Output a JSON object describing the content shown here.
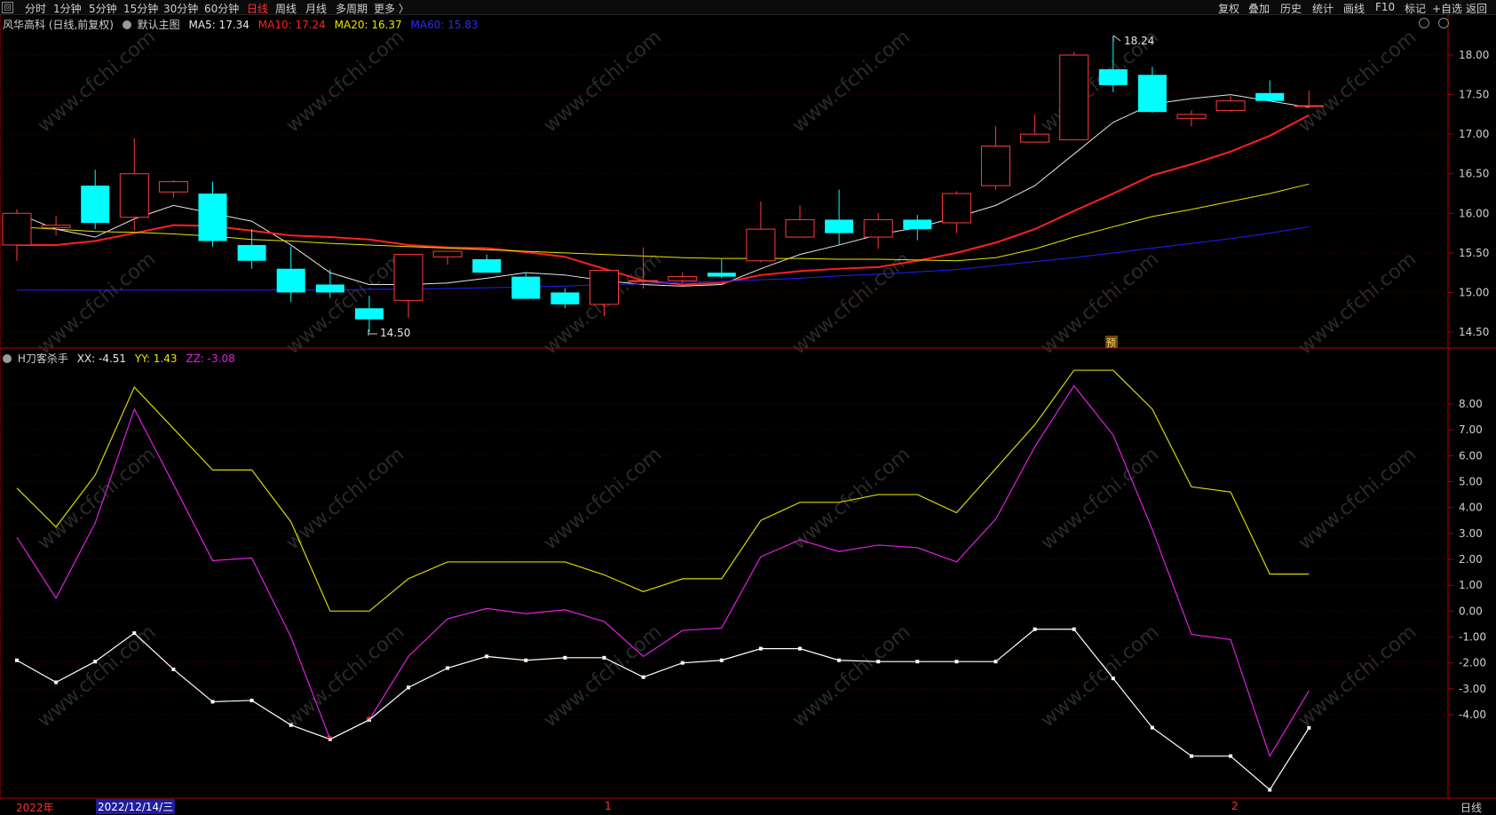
{
  "toolbar": {
    "app_icon": "回",
    "periods": [
      "分时",
      "1分钟",
      "5分钟",
      "15分钟",
      "30分钟",
      "60分钟",
      "日线",
      "周线",
      "月线",
      "多周期",
      "更多 〉"
    ],
    "active_period": "日线",
    "right_items": [
      "复权",
      "叠加",
      "历史",
      "统计",
      "画线",
      "F10",
      "标记",
      "+自选",
      "返回"
    ]
  },
  "main_legend": {
    "stock": "风华高科 (日线,前复权)",
    "chart_name": "默认主图",
    "ma5": "MA5: 17.34",
    "ma10": "MA10: 17.24",
    "ma20": "MA20: 16.37",
    "ma60": "MA60: 15.83"
  },
  "indicator_legend": {
    "name": "H刀客杀手",
    "xx": "XX: -4.51",
    "yy": "YY: 1.43",
    "zz": "ZZ: -3.08"
  },
  "annotations": {
    "high": "18.24",
    "low": "14.50",
    "forecast": "预"
  },
  "bottom": {
    "year": "2022年",
    "cursor_date": "2022/12/14/三",
    "month1": "1",
    "month2": "2",
    "period_tab": "日线"
  },
  "watermark": "www.cfchi.com",
  "colors": {
    "up": "#ff3c3c",
    "down": "#00ffff",
    "ma5": "#e6e6e6",
    "ma10": "#ff2020",
    "ma20": "#e6e600",
    "ma60": "#2020ff",
    "yy": "#d8d800",
    "zz": "#e020e0",
    "xx": "#ffffff",
    "axis": "#b00000"
  },
  "chart_data": [
    {
      "type": "candlestick",
      "title": "风华高科 (日线,前复权)",
      "ylim": [
        14.35,
        18.15
      ],
      "y_ticks": [
        14.5,
        15.0,
        15.5,
        16.0,
        16.5,
        17.0,
        17.5,
        18.0
      ],
      "y_tick_labels": [
        "14.50",
        "15.00",
        "15.50",
        "16.00",
        "16.50",
        "17.00",
        "17.50",
        "18.00"
      ],
      "candles": [
        {
          "o": 15.6,
          "h": 16.05,
          "l": 15.4,
          "c": 16.0
        },
        {
          "o": 15.82,
          "h": 15.97,
          "l": 15.72,
          "c": 15.85
        },
        {
          "o": 16.35,
          "h": 16.55,
          "l": 15.8,
          "c": 15.88
        },
        {
          "o": 15.95,
          "h": 16.95,
          "l": 15.78,
          "c": 16.5
        },
        {
          "o": 16.27,
          "h": 16.42,
          "l": 16.2,
          "c": 16.4
        },
        {
          "o": 16.25,
          "h": 16.4,
          "l": 15.58,
          "c": 15.65
        },
        {
          "o": 15.6,
          "h": 15.8,
          "l": 15.3,
          "c": 15.4
        },
        {
          "o": 15.3,
          "h": 15.58,
          "l": 14.88,
          "c": 15.0
        },
        {
          "o": 15.1,
          "h": 15.29,
          "l": 14.93,
          "c": 15.0
        },
        {
          "o": 14.8,
          "h": 14.96,
          "l": 14.5,
          "c": 14.66
        },
        {
          "o": 14.9,
          "h": 15.48,
          "l": 14.68,
          "c": 15.48
        },
        {
          "o": 15.45,
          "h": 15.52,
          "l": 15.35,
          "c": 15.52
        },
        {
          "o": 15.42,
          "h": 15.48,
          "l": 15.25,
          "c": 15.25
        },
        {
          "o": 15.2,
          "h": 15.25,
          "l": 14.92,
          "c": 14.92
        },
        {
          "o": 15.0,
          "h": 15.05,
          "l": 14.8,
          "c": 14.85
        },
        {
          "o": 14.85,
          "h": 15.28,
          "l": 14.7,
          "c": 15.28
        },
        {
          "o": 15.14,
          "h": 15.57,
          "l": 15.05,
          "c": 15.15
        },
        {
          "o": 15.15,
          "h": 15.25,
          "l": 15.12,
          "c": 15.2
        },
        {
          "o": 15.25,
          "h": 15.42,
          "l": 15.18,
          "c": 15.2
        },
        {
          "o": 15.4,
          "h": 16.15,
          "l": 15.38,
          "c": 15.8
        },
        {
          "o": 15.7,
          "h": 16.1,
          "l": 15.7,
          "c": 15.92
        },
        {
          "o": 15.92,
          "h": 16.3,
          "l": 15.6,
          "c": 15.75
        },
        {
          "o": 15.7,
          "h": 16.0,
          "l": 15.55,
          "c": 15.92
        },
        {
          "o": 15.92,
          "h": 15.98,
          "l": 15.66,
          "c": 15.8
        },
        {
          "o": 15.88,
          "h": 16.28,
          "l": 15.75,
          "c": 16.25
        },
        {
          "o": 16.35,
          "h": 17.1,
          "l": 16.3,
          "c": 16.85
        },
        {
          "o": 16.9,
          "h": 17.25,
          "l": 16.9,
          "c": 17.0
        },
        {
          "o": 16.93,
          "h": 18.04,
          "l": 16.92,
          "c": 18.0
        },
        {
          "o": 17.82,
          "h": 18.24,
          "l": 17.53,
          "c": 17.62
        },
        {
          "o": 17.75,
          "h": 17.85,
          "l": 17.27,
          "c": 17.28
        },
        {
          "o": 17.2,
          "h": 17.3,
          "l": 17.1,
          "c": 17.25
        },
        {
          "o": 17.3,
          "h": 17.48,
          "l": 17.28,
          "c": 17.42
        },
        {
          "o": 17.52,
          "h": 17.68,
          "l": 17.42,
          "c": 17.42
        },
        {
          "o": 17.36,
          "h": 17.55,
          "l": 17.33,
          "c": 17.36
        }
      ],
      "ma_series": [
        {
          "name": "MA5",
          "values": [
            16.0,
            15.8,
            15.7,
            15.93,
            16.1,
            16.0,
            15.9,
            15.6,
            15.25,
            15.1,
            15.1,
            15.12,
            15.18,
            15.25,
            15.22,
            15.15,
            15.1,
            15.08,
            15.1,
            15.3,
            15.48,
            15.6,
            15.73,
            15.82,
            15.95,
            16.1,
            16.35,
            16.75,
            17.15,
            17.38,
            17.45,
            17.5,
            17.42,
            17.34
          ]
        },
        {
          "name": "MA10",
          "values": [
            15.6,
            15.6,
            15.65,
            15.75,
            15.85,
            15.84,
            15.78,
            15.72,
            15.7,
            15.67,
            15.6,
            15.57,
            15.56,
            15.51,
            15.45,
            15.3,
            15.15,
            15.1,
            15.12,
            15.22,
            15.27,
            15.3,
            15.32,
            15.4,
            15.5,
            15.63,
            15.8,
            16.03,
            16.25,
            16.48,
            16.62,
            16.78,
            16.98,
            17.24
          ]
        },
        {
          "name": "MA20",
          "values": [
            15.83,
            15.8,
            15.77,
            15.76,
            15.74,
            15.71,
            15.67,
            15.65,
            15.62,
            15.6,
            15.58,
            15.56,
            15.54,
            15.52,
            15.5,
            15.48,
            15.46,
            15.44,
            15.43,
            15.43,
            15.43,
            15.42,
            15.42,
            15.41,
            15.4,
            15.44,
            15.55,
            15.7,
            15.83,
            15.96,
            16.05,
            16.15,
            16.25,
            16.37
          ]
        },
        {
          "name": "MA60",
          "values": [
            15.03,
            15.03,
            15.03,
            15.03,
            15.03,
            15.03,
            15.03,
            15.03,
            15.03,
            15.04,
            15.04,
            15.05,
            15.06,
            15.07,
            15.08,
            15.1,
            15.11,
            15.13,
            15.14,
            15.16,
            15.18,
            15.21,
            15.23,
            15.26,
            15.29,
            15.34,
            15.39,
            15.44,
            15.5,
            15.56,
            15.62,
            15.68,
            15.75,
            15.83
          ]
        }
      ]
    },
    {
      "type": "line",
      "title": "H刀客杀手",
      "ylim": [
        -7.0,
        9.3
      ],
      "y_ticks": [
        -4,
        -3,
        -2,
        -1,
        0,
        1,
        2,
        3,
        4,
        5,
        6,
        7,
        8
      ],
      "y_tick_labels": [
        "-4.00",
        "-3.00",
        "-2.00",
        "-1.00",
        "0.00",
        "1.00",
        "2.00",
        "3.00",
        "4.00",
        "5.00",
        "6.00",
        "7.00",
        "8.00"
      ],
      "series": [
        {
          "name": "YY",
          "values": [
            4.75,
            3.25,
            5.25,
            8.65,
            7.05,
            5.45,
            5.45,
            3.45,
            0.0,
            0.0,
            1.25,
            1.9,
            1.9,
            1.9,
            1.9,
            1.4,
            0.75,
            1.25,
            1.25,
            3.5,
            4.2,
            4.2,
            4.5,
            4.5,
            3.8,
            5.5,
            7.2,
            9.3,
            9.3,
            7.8,
            4.8,
            4.6,
            1.43,
            1.43
          ]
        },
        {
          "name": "ZZ",
          "values": [
            2.85,
            0.5,
            3.4,
            7.8,
            4.9,
            1.95,
            2.05,
            -1.0,
            -4.95,
            -4.2,
            -1.75,
            -0.3,
            0.1,
            -0.1,
            0.05,
            -0.4,
            -1.75,
            -0.75,
            -0.65,
            2.1,
            2.75,
            2.3,
            2.55,
            2.45,
            1.9,
            3.55,
            6.35,
            8.7,
            6.8,
            3.15,
            -0.9,
            -1.1,
            -5.6,
            -3.08
          ]
        },
        {
          "name": "XX",
          "values": [
            -1.9,
            -2.75,
            -1.95,
            -0.85,
            -2.25,
            -3.5,
            -3.45,
            -4.4,
            -4.95,
            -4.2,
            -2.95,
            -2.2,
            -1.75,
            -1.9,
            -1.8,
            -1.8,
            -2.55,
            -2.0,
            -1.9,
            -1.45,
            -1.45,
            -1.9,
            -1.95,
            -1.95,
            -1.95,
            -1.95,
            -0.7,
            -0.7,
            -2.6,
            -4.5,
            -5.6,
            -5.6,
            -6.9,
            -4.51
          ]
        }
      ],
      "signals": [
        "star at bar 9",
        "star at bar 10"
      ]
    }
  ]
}
